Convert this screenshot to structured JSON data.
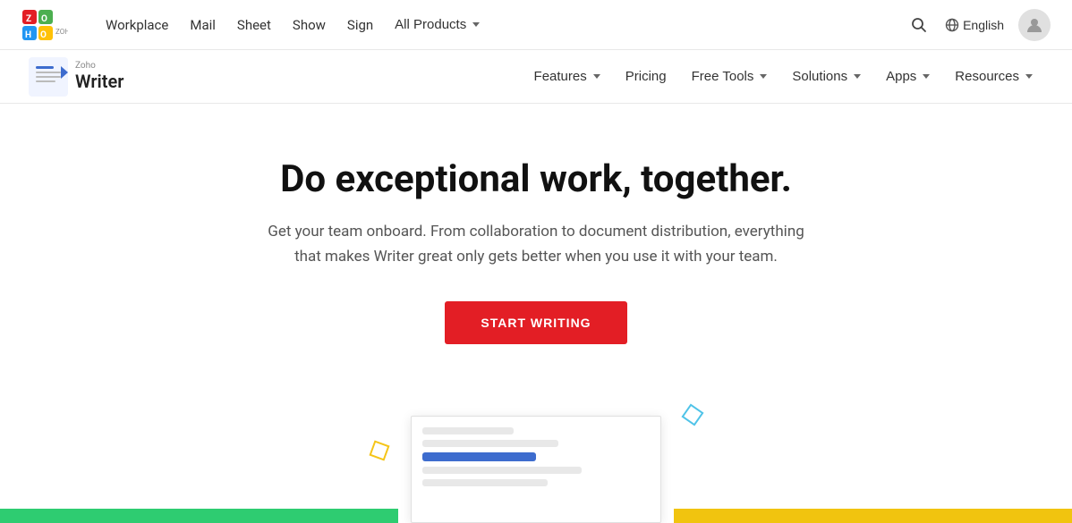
{
  "top_nav": {
    "logo_alt": "Zoho Logo",
    "links": [
      {
        "label": "Workplace",
        "name": "workplace-link"
      },
      {
        "label": "Mail",
        "name": "mail-link"
      },
      {
        "label": "Sheet",
        "name": "sheet-link"
      },
      {
        "label": "Show",
        "name": "show-link"
      },
      {
        "label": "Sign",
        "name": "sign-link"
      }
    ],
    "all_products_label": "All Products",
    "search_label": "Search",
    "language_label": "English",
    "avatar_label": "User Avatar"
  },
  "secondary_nav": {
    "zoho_label": "Zoho",
    "writer_label": "Writer",
    "links": [
      {
        "label": "Features",
        "name": "features-link",
        "has_dropdown": true
      },
      {
        "label": "Pricing",
        "name": "pricing-link",
        "has_dropdown": false
      },
      {
        "label": "Free Tools",
        "name": "free-tools-link",
        "has_dropdown": true
      },
      {
        "label": "Solutions",
        "name": "solutions-link",
        "has_dropdown": true
      },
      {
        "label": "Apps",
        "name": "apps-link",
        "has_dropdown": true
      },
      {
        "label": "Resources",
        "name": "resources-link",
        "has_dropdown": true
      }
    ]
  },
  "hero": {
    "title": "Do exceptional work, together.",
    "subtitle": "Get your team onboard. From collaboration to document distribution, everything that makes Writer great only gets better when you use it with your team.",
    "cta_label": "START WRITING"
  }
}
